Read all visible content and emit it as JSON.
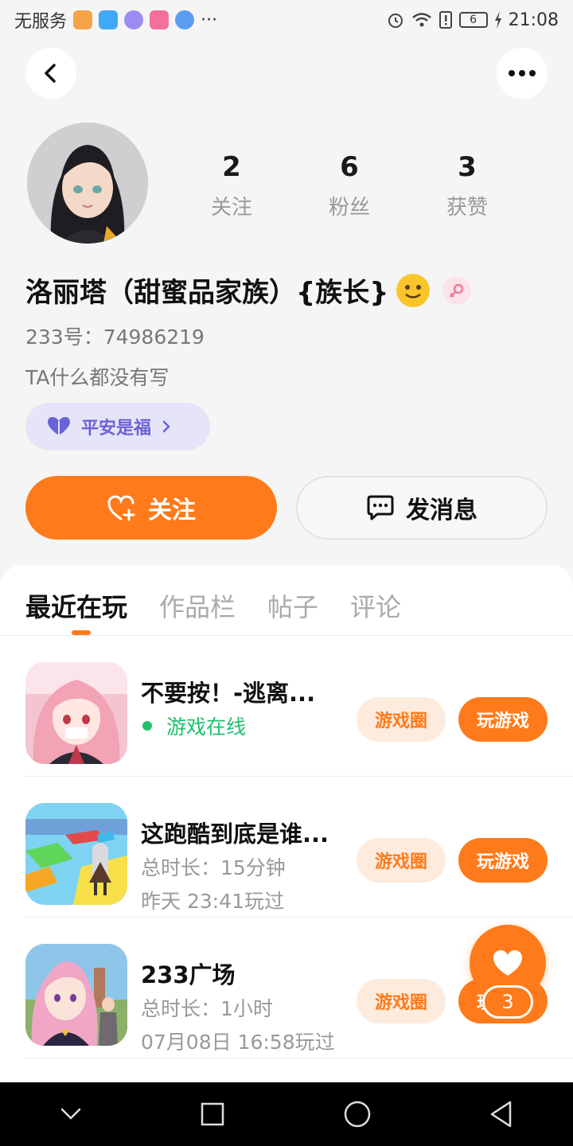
{
  "status_bar": {
    "carrier": "无服务",
    "more": "···",
    "battery": "6",
    "time": "21:08"
  },
  "profile": {
    "stats": [
      {
        "num": "2",
        "label": "关注"
      },
      {
        "num": "6",
        "label": "粉丝"
      },
      {
        "num": "3",
        "label": "获赞"
      }
    ],
    "name": "洛丽塔（甜蜜品家族）{族长}",
    "user_id": "233号：74986219",
    "bio": "TA什么都没有写",
    "family_tag": "平安是福"
  },
  "actions": {
    "follow": "关注",
    "message": "发消息"
  },
  "tabs": [
    "最近在玩",
    "作品栏",
    "帖子",
    "评论"
  ],
  "games": [
    {
      "title": "不要按！-逃离...",
      "line1": "游戏在线",
      "line2": ""
    },
    {
      "title": "这跑酷到底是谁...",
      "line1": "总时长：15分钟",
      "line2": "昨天 23:41玩过"
    },
    {
      "title": "233广场",
      "line1": "总时长：1小时",
      "line2": "07月08日 16:58玩过"
    }
  ],
  "game_buttons": {
    "circle": "游戏圈",
    "play": "玩游戏"
  },
  "like_float": {
    "count": "3"
  },
  "colors": {
    "accent": "#fe7a1a",
    "online": "#1fc16b",
    "family": "#6a62d8"
  }
}
